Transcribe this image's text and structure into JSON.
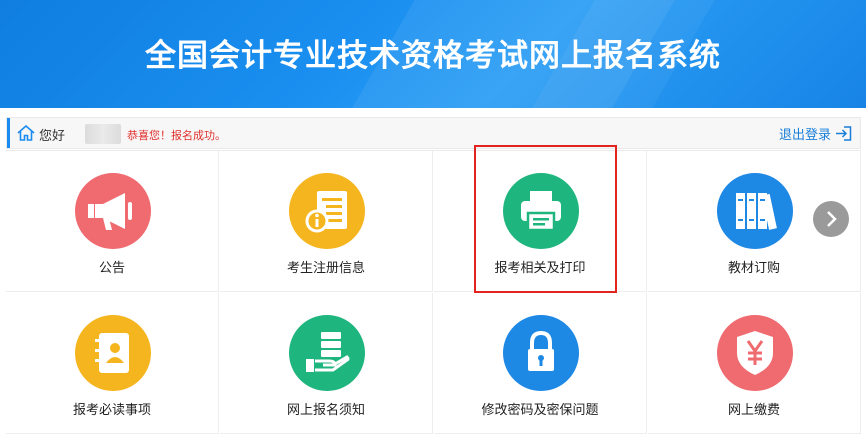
{
  "header": {
    "title": "全国会计专业技术资格考试网上报名系统"
  },
  "greeting": {
    "hello": "您好",
    "message": "恭喜您！报名成功。",
    "logout_label": "退出登录"
  },
  "tiles": [
    {
      "label": "公告",
      "icon": "megaphone-icon",
      "color": "#ef6b70"
    },
    {
      "label": "考生注册信息",
      "icon": "document-info-icon",
      "color": "#f5b51e"
    },
    {
      "label": "报考相关及打印",
      "icon": "printer-icon",
      "color": "#1fb57e"
    },
    {
      "label": "教材订购",
      "icon": "books-icon",
      "color": "#1e88e5"
    },
    {
      "label": "报考必读事项",
      "icon": "contact-book-icon",
      "color": "#f5b51e"
    },
    {
      "label": "网上报名须知",
      "icon": "server-hand-icon",
      "color": "#1fb57e"
    },
    {
      "label": "修改密码及密保问题",
      "icon": "padlock-icon",
      "color": "#1e88e5"
    },
    {
      "label": "网上缴费",
      "icon": "yen-shield-icon",
      "color": "#ef6b70"
    }
  ],
  "colors": {
    "banner": "#1a8ff0",
    "highlight_box": "#e3231e",
    "message": "#e0302c",
    "link": "#1a7fd8"
  }
}
